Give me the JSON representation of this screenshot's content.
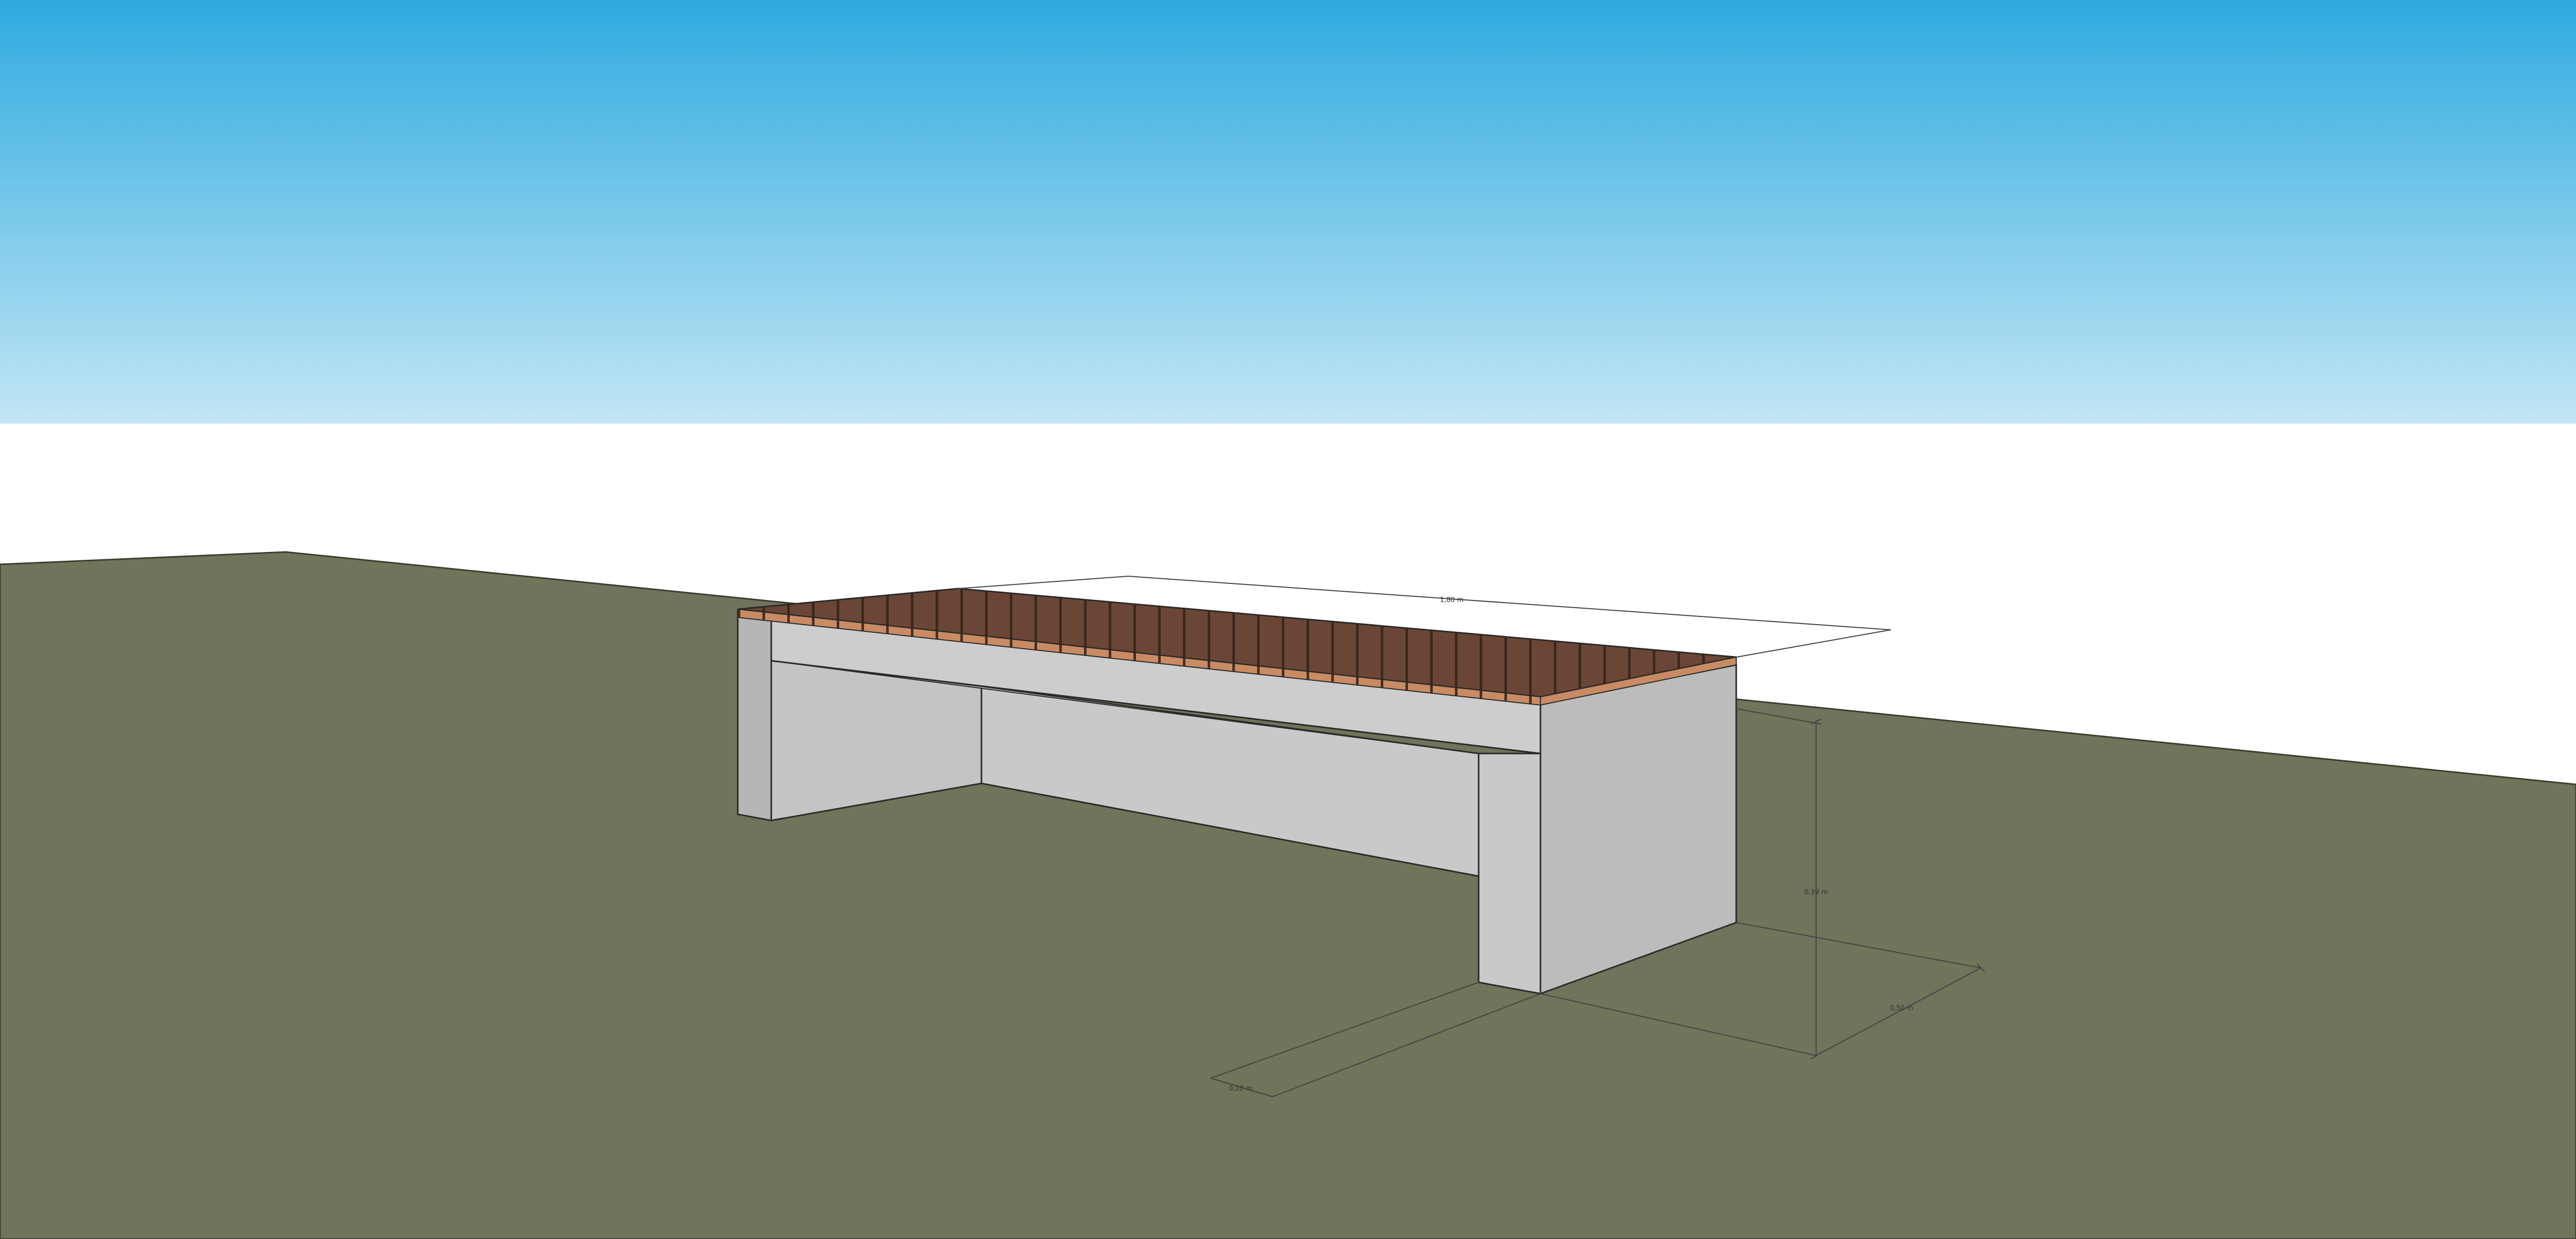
{
  "scene": {
    "colors": {
      "sky_top": "#2eaae0",
      "sky_bottom": "#c3e6f5",
      "ground": "#71735a",
      "concrete_light": "#cbcbcb",
      "concrete_dark": "#b3b3b3",
      "wood_top": "#6b4636",
      "wood_edge": "#c98b63"
    },
    "objects": {
      "bench": "concrete bench with wooden slat seat"
    },
    "dimensions": {
      "length": "1,80 m",
      "height": "0,39 m",
      "depth": "0,50 m",
      "leg_width": "0,10 m"
    }
  }
}
